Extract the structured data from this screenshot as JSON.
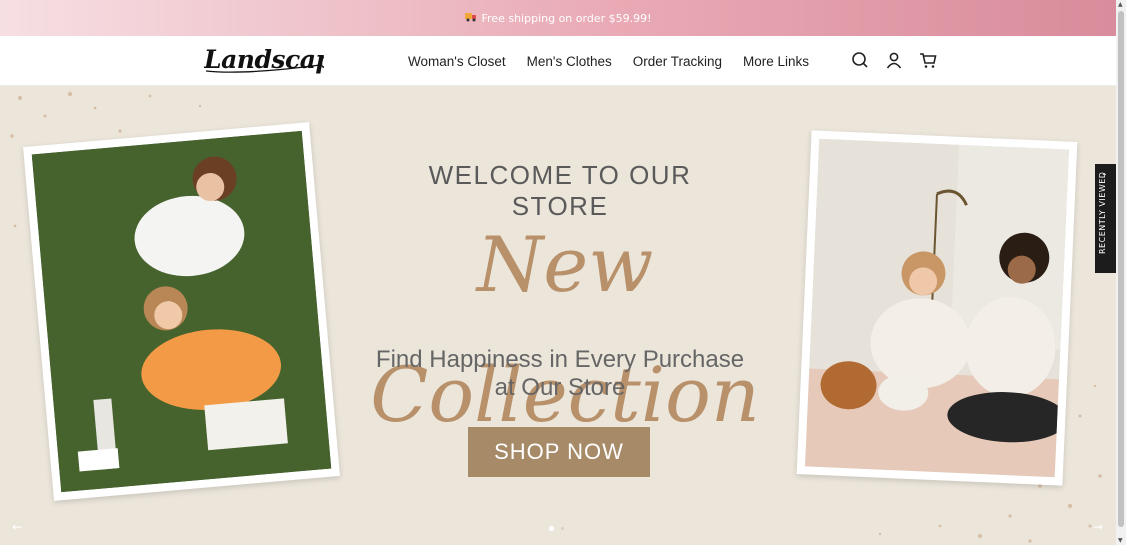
{
  "announcement": {
    "icon": "truck-icon",
    "text": "Free shipping on order $59.99!"
  },
  "header": {
    "logo_text": "Landscapet",
    "nav": [
      {
        "label": "Woman's Closet"
      },
      {
        "label": "Men's Clothes"
      },
      {
        "label": "Order Tracking"
      },
      {
        "label": "More Links"
      }
    ],
    "icons": [
      "search-icon",
      "account-icon",
      "cart-icon"
    ]
  },
  "hero": {
    "welcome": "WELCOME TO OUR STORE",
    "script_title": "New Collection",
    "tagline_line1": "Find Happiness in Every Purchase",
    "tagline_line2": "at Our Store",
    "cta": "SHOP NOW",
    "slides_total": 2,
    "active_slide": 1
  },
  "recently_viewed": {
    "label": "RECENTLY VIEWED"
  },
  "colors": {
    "accent": "#a78a67",
    "script": "#b8916a",
    "announce_pink": "#e9aab5",
    "hero_bg": "#ebe5da"
  }
}
